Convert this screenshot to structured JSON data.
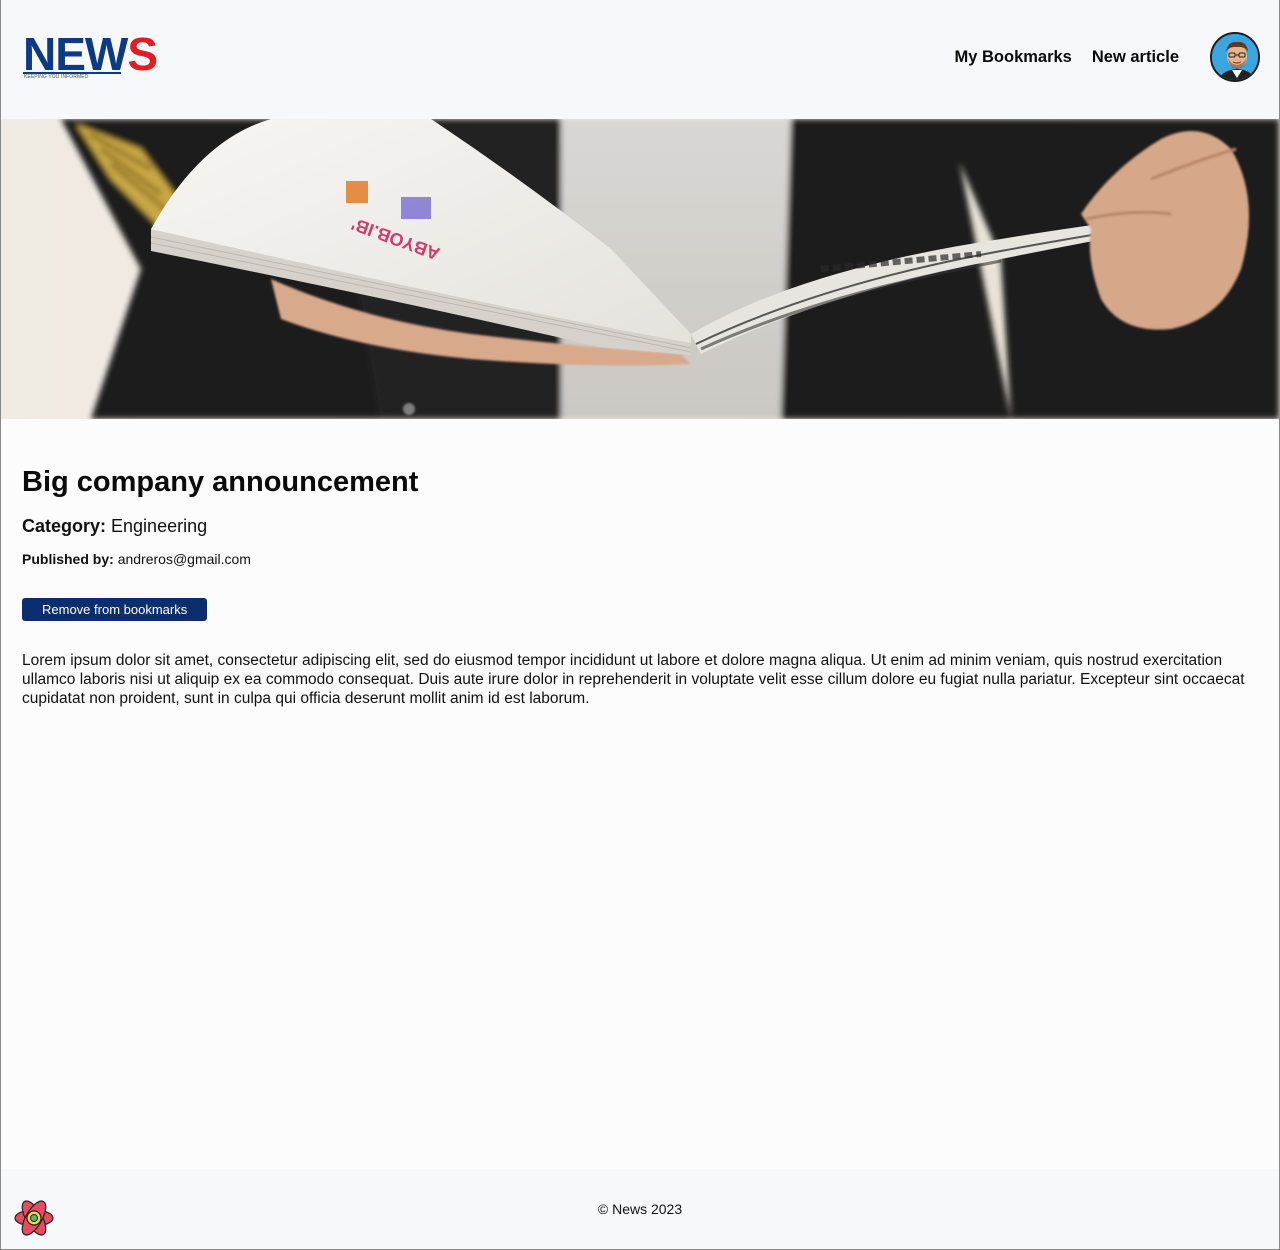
{
  "header": {
    "logo": {
      "letters_blue": "NEW",
      "letters_red": "S",
      "tagline": "KEEPING YOU INFORMED"
    },
    "nav": {
      "bookmarks": "My Bookmarks",
      "new_article": "New article"
    },
    "avatar_icon": "user-avatar-icon"
  },
  "hero": {
    "description": "magazine-photo"
  },
  "article": {
    "title": "Big company announcement",
    "category_label": "Category:",
    "category_value": "Engineering",
    "published_label": "Published by:",
    "published_value": "andreros@gmail.com",
    "bookmark_button": "Remove from bookmarks",
    "body": "Lorem ipsum dolor sit amet, consectetur adipiscing elit, sed do eiusmod tempor incididunt ut labore et dolore magna aliqua. Ut enim ad minim veniam, quis nostrud exercitation ullamco laboris nisi ut aliquip ex ea commodo consequat. Duis aute irure dolor in reprehenderit in voluptate velit esse cillum dolore eu fugiat nulla pariatur. Excepteur sint occaecat cupidatat non proident, sunt in culpa qui officia deserunt mollit anim id est laborum."
  },
  "footer": {
    "copyright": "© News 2023",
    "logo_icon": "react-atom-icon"
  },
  "colors": {
    "brand_blue": "#0c3b83",
    "brand_red": "#e31b23",
    "button_bg": "#0c2e6e",
    "header_bg": "#f6f8fb"
  }
}
